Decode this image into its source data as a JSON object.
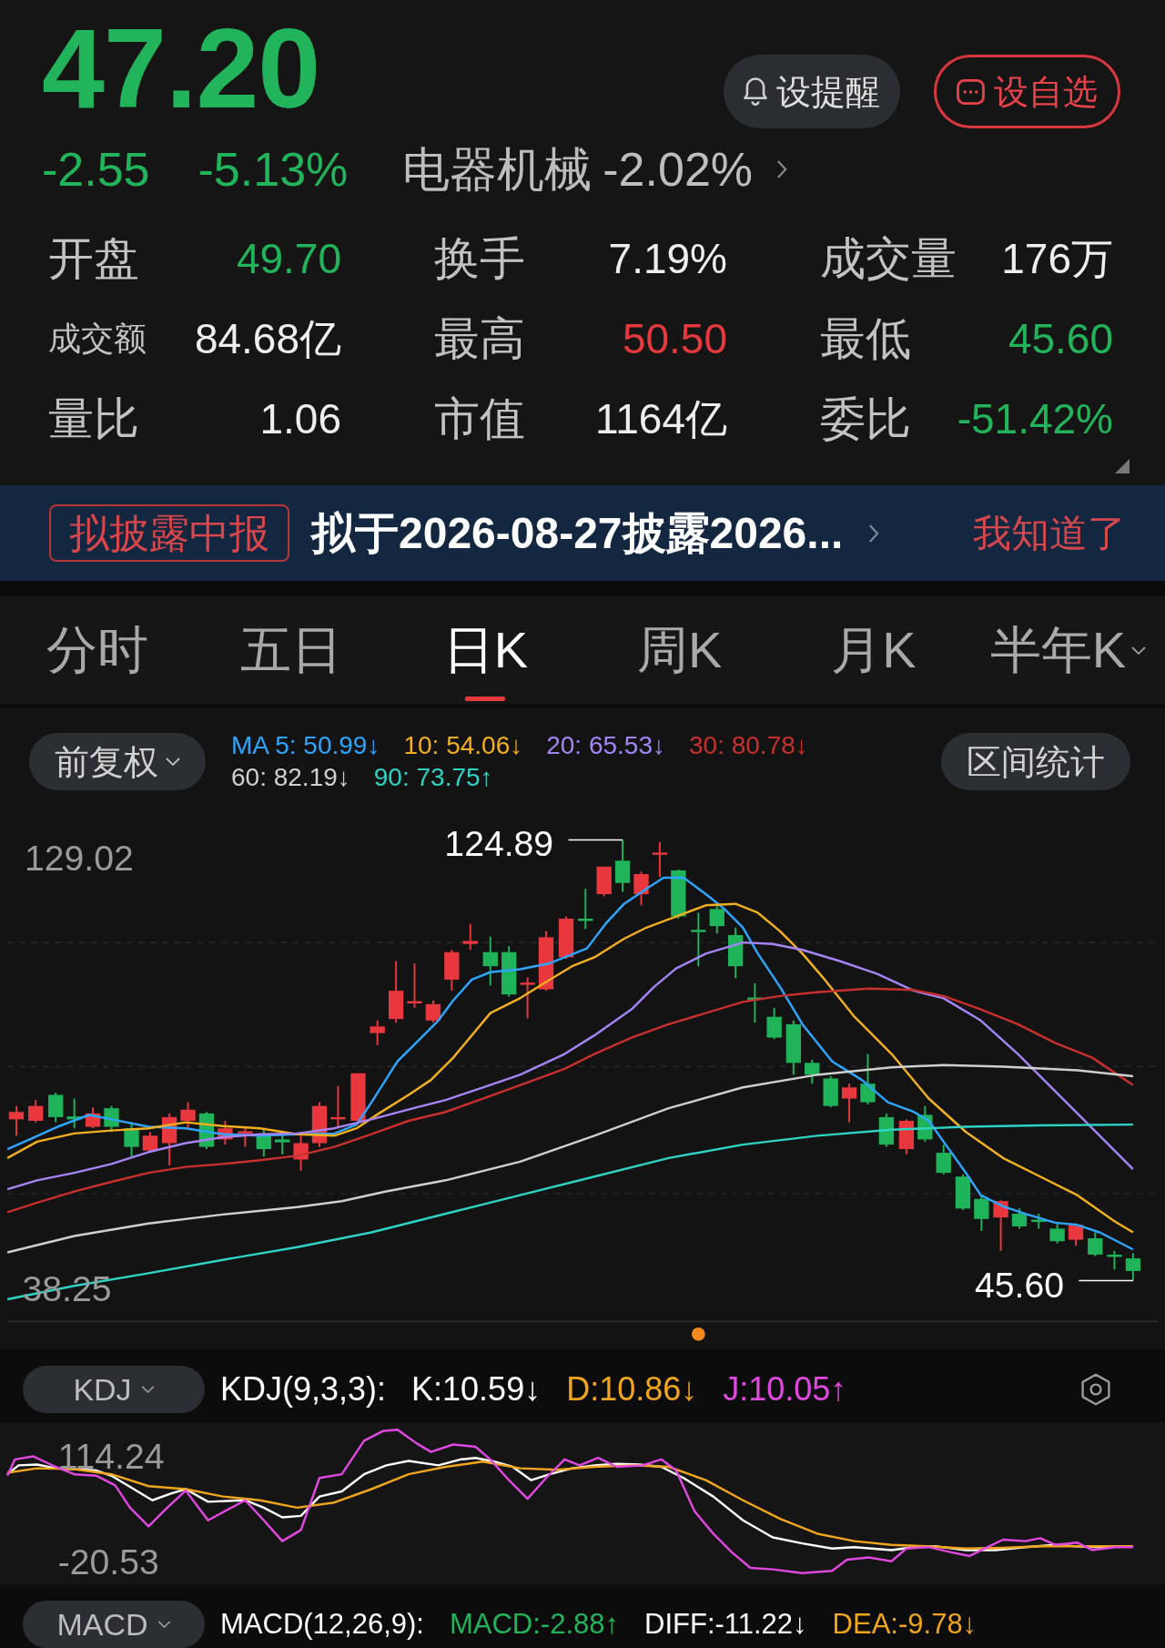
{
  "quote": {
    "price": "47.20",
    "change": "-2.55",
    "change_percent": "-5.13%",
    "rising": false,
    "sector": "电器机械",
    "sector_change": "-2.02%"
  },
  "actions": [
    {
      "kind": "bell",
      "label": "设提醒"
    },
    {
      "kind": "watchlist",
      "label": "设自选"
    }
  ],
  "stats": [
    {
      "label": "开盘",
      "value": "49.70",
      "color": "#21b45b",
      "compact_label": false
    },
    {
      "label": "换手",
      "value": "7.19%",
      "color": "#eeeeee",
      "compact_label": false
    },
    {
      "label": "成交量",
      "value": "176万",
      "color": "#eeeeee",
      "compact_label": false
    },
    {
      "label": "成交额",
      "value": "84.68亿",
      "color": "#eeeeee",
      "compact_label": true
    },
    {
      "label": "最高",
      "value": "50.50",
      "color": "#e5393e",
      "compact_label": false
    },
    {
      "label": "最低",
      "value": "45.60",
      "color": "#21b45b",
      "compact_label": false
    },
    {
      "label": "量比",
      "value": "1.06",
      "color": "#eeeeee",
      "compact_label": false
    },
    {
      "label": "市值",
      "value": "1164亿",
      "color": "#eeeeee",
      "compact_label": false
    },
    {
      "label": "委比",
      "value": "-51.42%",
      "color": "#21b45b",
      "compact_label": false
    }
  ],
  "notice": {
    "tag": "拟披露中报",
    "text": "拟于2026-08-27披露2026...",
    "dismiss": "我知道了"
  },
  "period_tabs": [
    {
      "label": "分时",
      "selected": false,
      "dropdown": false
    },
    {
      "label": "五日",
      "selected": false,
      "dropdown": false
    },
    {
      "label": "日K",
      "selected": true,
      "dropdown": false
    },
    {
      "label": "周K",
      "selected": false,
      "dropdown": false
    },
    {
      "label": "月K",
      "selected": false,
      "dropdown": false
    },
    {
      "label": "半年K",
      "selected": false,
      "dropdown": true
    }
  ],
  "chart": {
    "adjustment": "前复权",
    "ma_legend": [
      {
        "text": "MA 5: 50.99↓",
        "color": "#2ea6ff"
      },
      {
        "text": "10: 54.06↓",
        "color": "#f2b01e"
      },
      {
        "text": "20: 65.53↓",
        "color": "#a585f5"
      },
      {
        "text": "30: 80.78↓",
        "color": "#c8302e"
      },
      {
        "text": "60: 82.19↓",
        "color": "#cfcfcf"
      },
      {
        "text": "90: 73.75↑",
        "color": "#2fd3c4"
      }
    ],
    "range_button": "区间统计",
    "axis_max": "129.02",
    "axis_min": "38.25",
    "high_label": "124.89",
    "low_label": "45.60"
  },
  "indicators": [
    {
      "kind": "kdj",
      "name": "KDJ",
      "params": "KDJ(9,3,3):",
      "values": [
        {
          "text": "K:10.59↓",
          "color": "#ffffff"
        },
        {
          "text": "D:10.86↓",
          "color": "#f0a51c"
        },
        {
          "text": "J:10.05↑",
          "color": "#e048e0"
        }
      ],
      "settings": true,
      "axis_max": "114.24",
      "axis_min": "-20.53"
    },
    {
      "kind": "macd",
      "name": "MACD",
      "params": "MACD(12,26,9):",
      "values": [
        {
          "text": "MACD:-2.88↑",
          "color": "#22b45a"
        },
        {
          "text": "DIFF:-11.22↓",
          "color": "#ffffff"
        },
        {
          "text": "DEA:-9.78↓",
          "color": "#f0a51c"
        }
      ],
      "settings": false
    }
  ]
}
